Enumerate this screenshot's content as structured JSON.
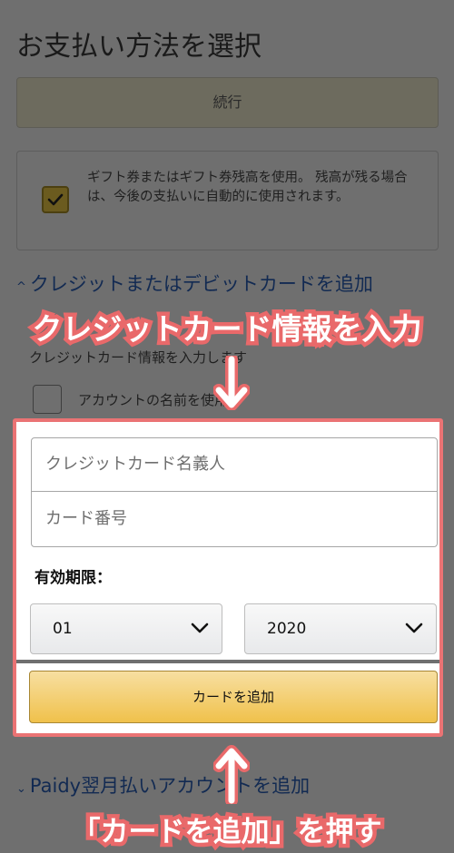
{
  "page": {
    "title": "お支払い方法を選択",
    "continue_label": "続行"
  },
  "gift": {
    "text": "ギフト券またはギフト券残高を使用。 残高が残る場合は、今後の支払いに自動的に使用されます。",
    "checked": true
  },
  "credit": {
    "heading": "クレジットまたはデビットカードを追加",
    "heading_chevron": "^",
    "intro": "クレジットカード情報を入力します",
    "use_account_name_label": "アカウントの名前を使用",
    "name_placeholder": "クレジットカード名義人",
    "number_placeholder": "カード番号",
    "expiry_label": "有効期限：",
    "month_value": "01",
    "year_value": "2020",
    "add_card_label": "カードを追加"
  },
  "paidy": {
    "label": "Paidy翌月払いアカウントを追加",
    "chevron": "⌄"
  },
  "annotations": {
    "top": "クレジットカード情報を入力",
    "bottom": "「カードを追加」を押す"
  },
  "colors": {
    "highlight": "#ea7374",
    "link": "#122a52",
    "add_button": "#f0c14b"
  }
}
